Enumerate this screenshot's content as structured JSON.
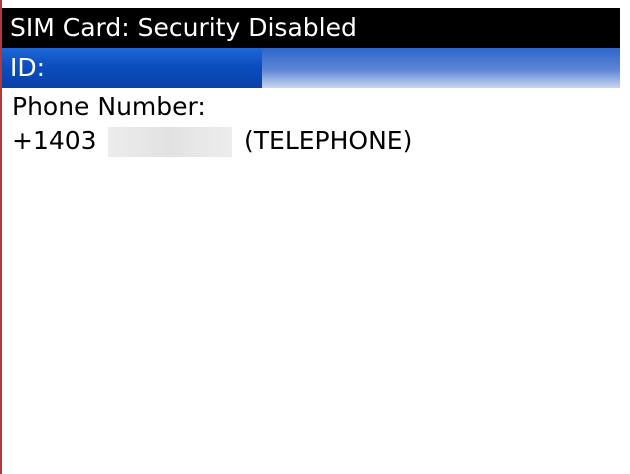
{
  "header": {
    "title": "SIM Card: Security Disabled"
  },
  "fields": {
    "id_label": "ID:",
    "phone_label": "Phone Number:",
    "phone_prefix": "+1403",
    "phone_type": "(TELEPHONE)"
  },
  "colors": {
    "title_bar_bg": "#000000",
    "selection_bg": "#0b4cbd",
    "text": "#000000"
  }
}
